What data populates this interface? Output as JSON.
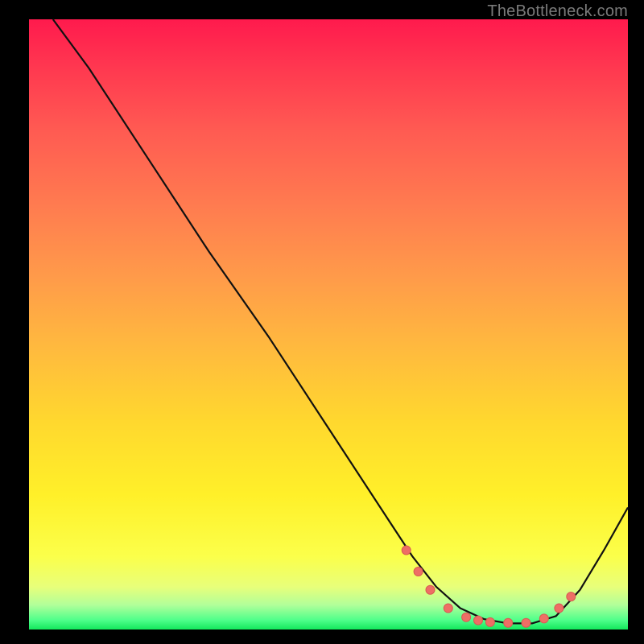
{
  "watermark": "TheBottleneck.com",
  "colors": {
    "frame": "#000000",
    "curve_stroke": "#111111",
    "dot_fill": "#ee6e65",
    "dot_stroke": "#d85b52"
  },
  "chart_data": {
    "type": "line",
    "title": "",
    "xlabel": "",
    "ylabel": "",
    "xlim": [
      0,
      100
    ],
    "ylim": [
      0,
      100
    ],
    "series": [
      {
        "name": "bottleneck-curve",
        "x": [
          4,
          10,
          20,
          30,
          40,
          50,
          60,
          64,
          68,
          72,
          76,
          80,
          84,
          88,
          92,
          96,
          100
        ],
        "values": [
          100,
          92,
          77,
          62,
          48,
          33,
          18,
          12,
          7,
          3.5,
          1.7,
          1.0,
          1.0,
          2.2,
          6.5,
          13,
          20
        ]
      }
    ],
    "markers": {
      "name": "optimal-range-dots",
      "x": [
        63,
        65,
        67,
        70,
        73,
        75,
        77,
        80,
        83,
        86,
        88.5,
        90.5
      ],
      "values": [
        13,
        9.5,
        6.5,
        3.5,
        2.0,
        1.5,
        1.2,
        1.1,
        1.1,
        1.8,
        3.5,
        5.4
      ]
    }
  }
}
